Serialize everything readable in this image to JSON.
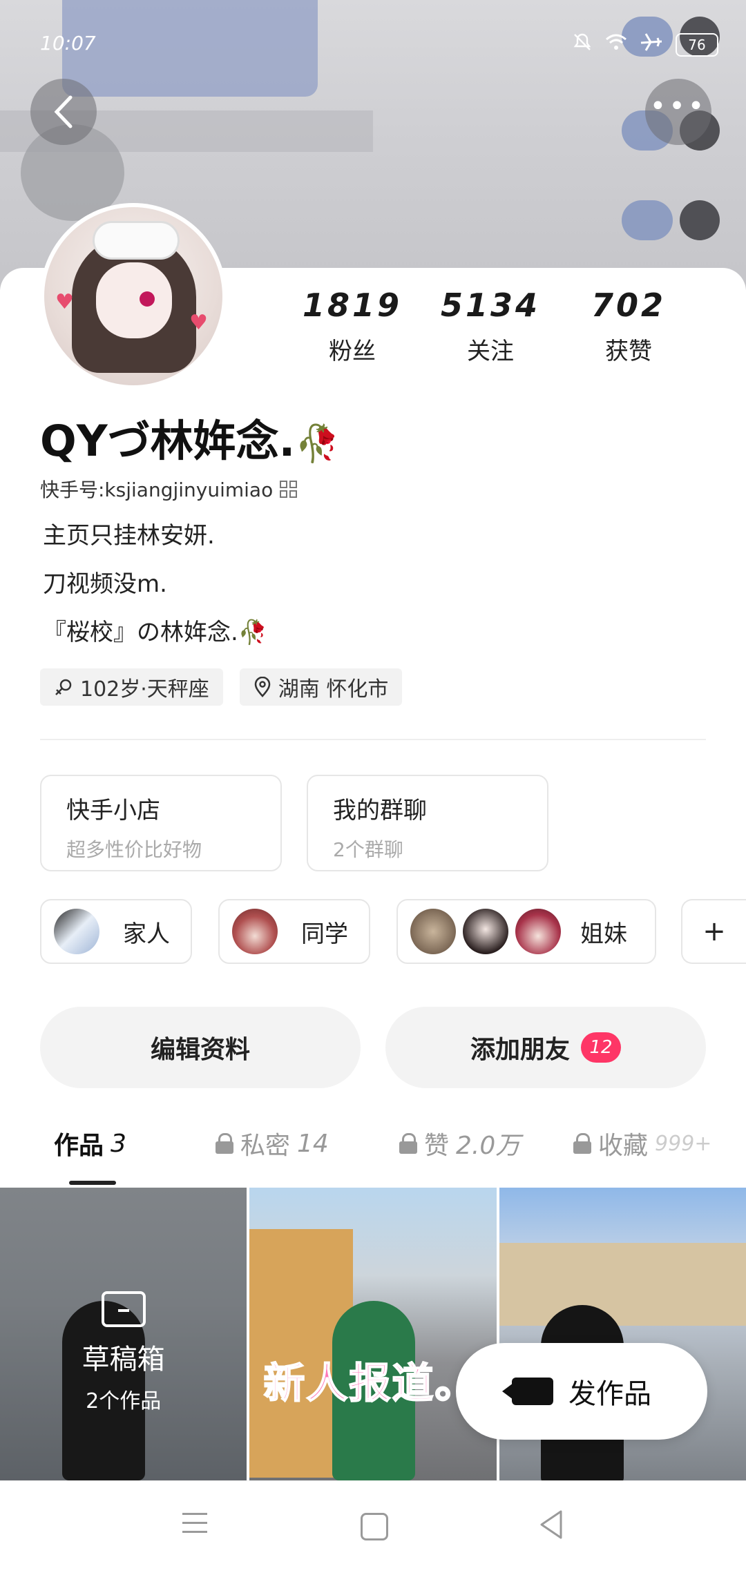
{
  "status_bar": {
    "time": "10:07",
    "battery": "76"
  },
  "profile": {
    "name": "QYづ林姩念.",
    "kuaishou_id": "快手号:ksjiangjinyuimiao",
    "bio": [
      "主页只挂林安妍.",
      "刀视频没m.",
      "『桜校』の林姩念."
    ],
    "tags": [
      {
        "icon": "gender-icon",
        "text": "102岁·天秤座"
      },
      {
        "icon": "location-icon",
        "text": "湖南 怀化市"
      }
    ]
  },
  "stats": [
    {
      "value": "1819",
      "label": "粉丝"
    },
    {
      "value": "5134",
      "label": "关注"
    },
    {
      "value": "702",
      "label": "获赞"
    }
  ],
  "cards": [
    {
      "title": "快手小店",
      "subtitle": "超多性价比好物"
    },
    {
      "title": "我的群聊",
      "subtitle": "2个群聊"
    }
  ],
  "groups": [
    {
      "label": "家人"
    },
    {
      "label": "同学"
    },
    {
      "label": "姐妹"
    }
  ],
  "add_group": "+",
  "actions": {
    "edit": "编辑资料",
    "add_friend": "添加朋友",
    "add_friend_badge": "12"
  },
  "tabs": [
    {
      "label": "作品",
      "count": "3"
    },
    {
      "label": "私密",
      "count": "14"
    },
    {
      "label": "赞",
      "count": "2.0万"
    },
    {
      "label": "收藏",
      "count": "999+"
    }
  ],
  "grid": {
    "draft_title": "草稿箱",
    "draft_sub": "2个作品",
    "video2_text": "新人报道。"
  },
  "publish": "发作品",
  "colors": {
    "accent": "#fe3666"
  }
}
